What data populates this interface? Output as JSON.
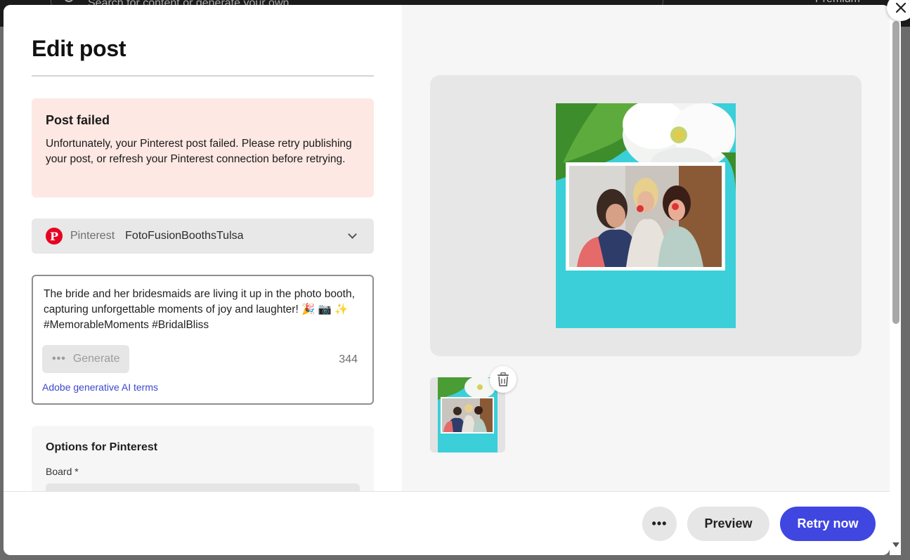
{
  "backdrop": {
    "search_placeholder": "Search for content or generate your own",
    "premium_label": "Premium"
  },
  "modal": {
    "title": "Edit post",
    "alert": {
      "title": "Post failed",
      "body": "Unfortunately, your Pinterest post failed. Please retry publishing your post, or refresh your Pinterest connection before retrying."
    },
    "account": {
      "platform": "Pinterest",
      "name": "FotoFusionBoothsTulsa",
      "icon": "pinterest-logo-icon"
    },
    "caption": {
      "text": "The bride and her bridesmaids are living it up in the photo booth, capturing unforgettable moments of joy and laughter! 🎉 📷 ✨ #MemorableMoments #BridalBliss",
      "generate_label": "Generate",
      "char_count": "344",
      "ai_terms_link": "Adobe generative AI terms"
    },
    "options": {
      "title": "Options for Pinterest",
      "board_label": "Board *"
    },
    "footer": {
      "more_label": "•••",
      "preview_label": "Preview",
      "retry_label": "Retry now"
    },
    "colors": {
      "accent": "#4046e0",
      "alert_bg": "#fde8e3",
      "pinterest_red": "#e60023",
      "teal": "#3bcfd9"
    }
  }
}
